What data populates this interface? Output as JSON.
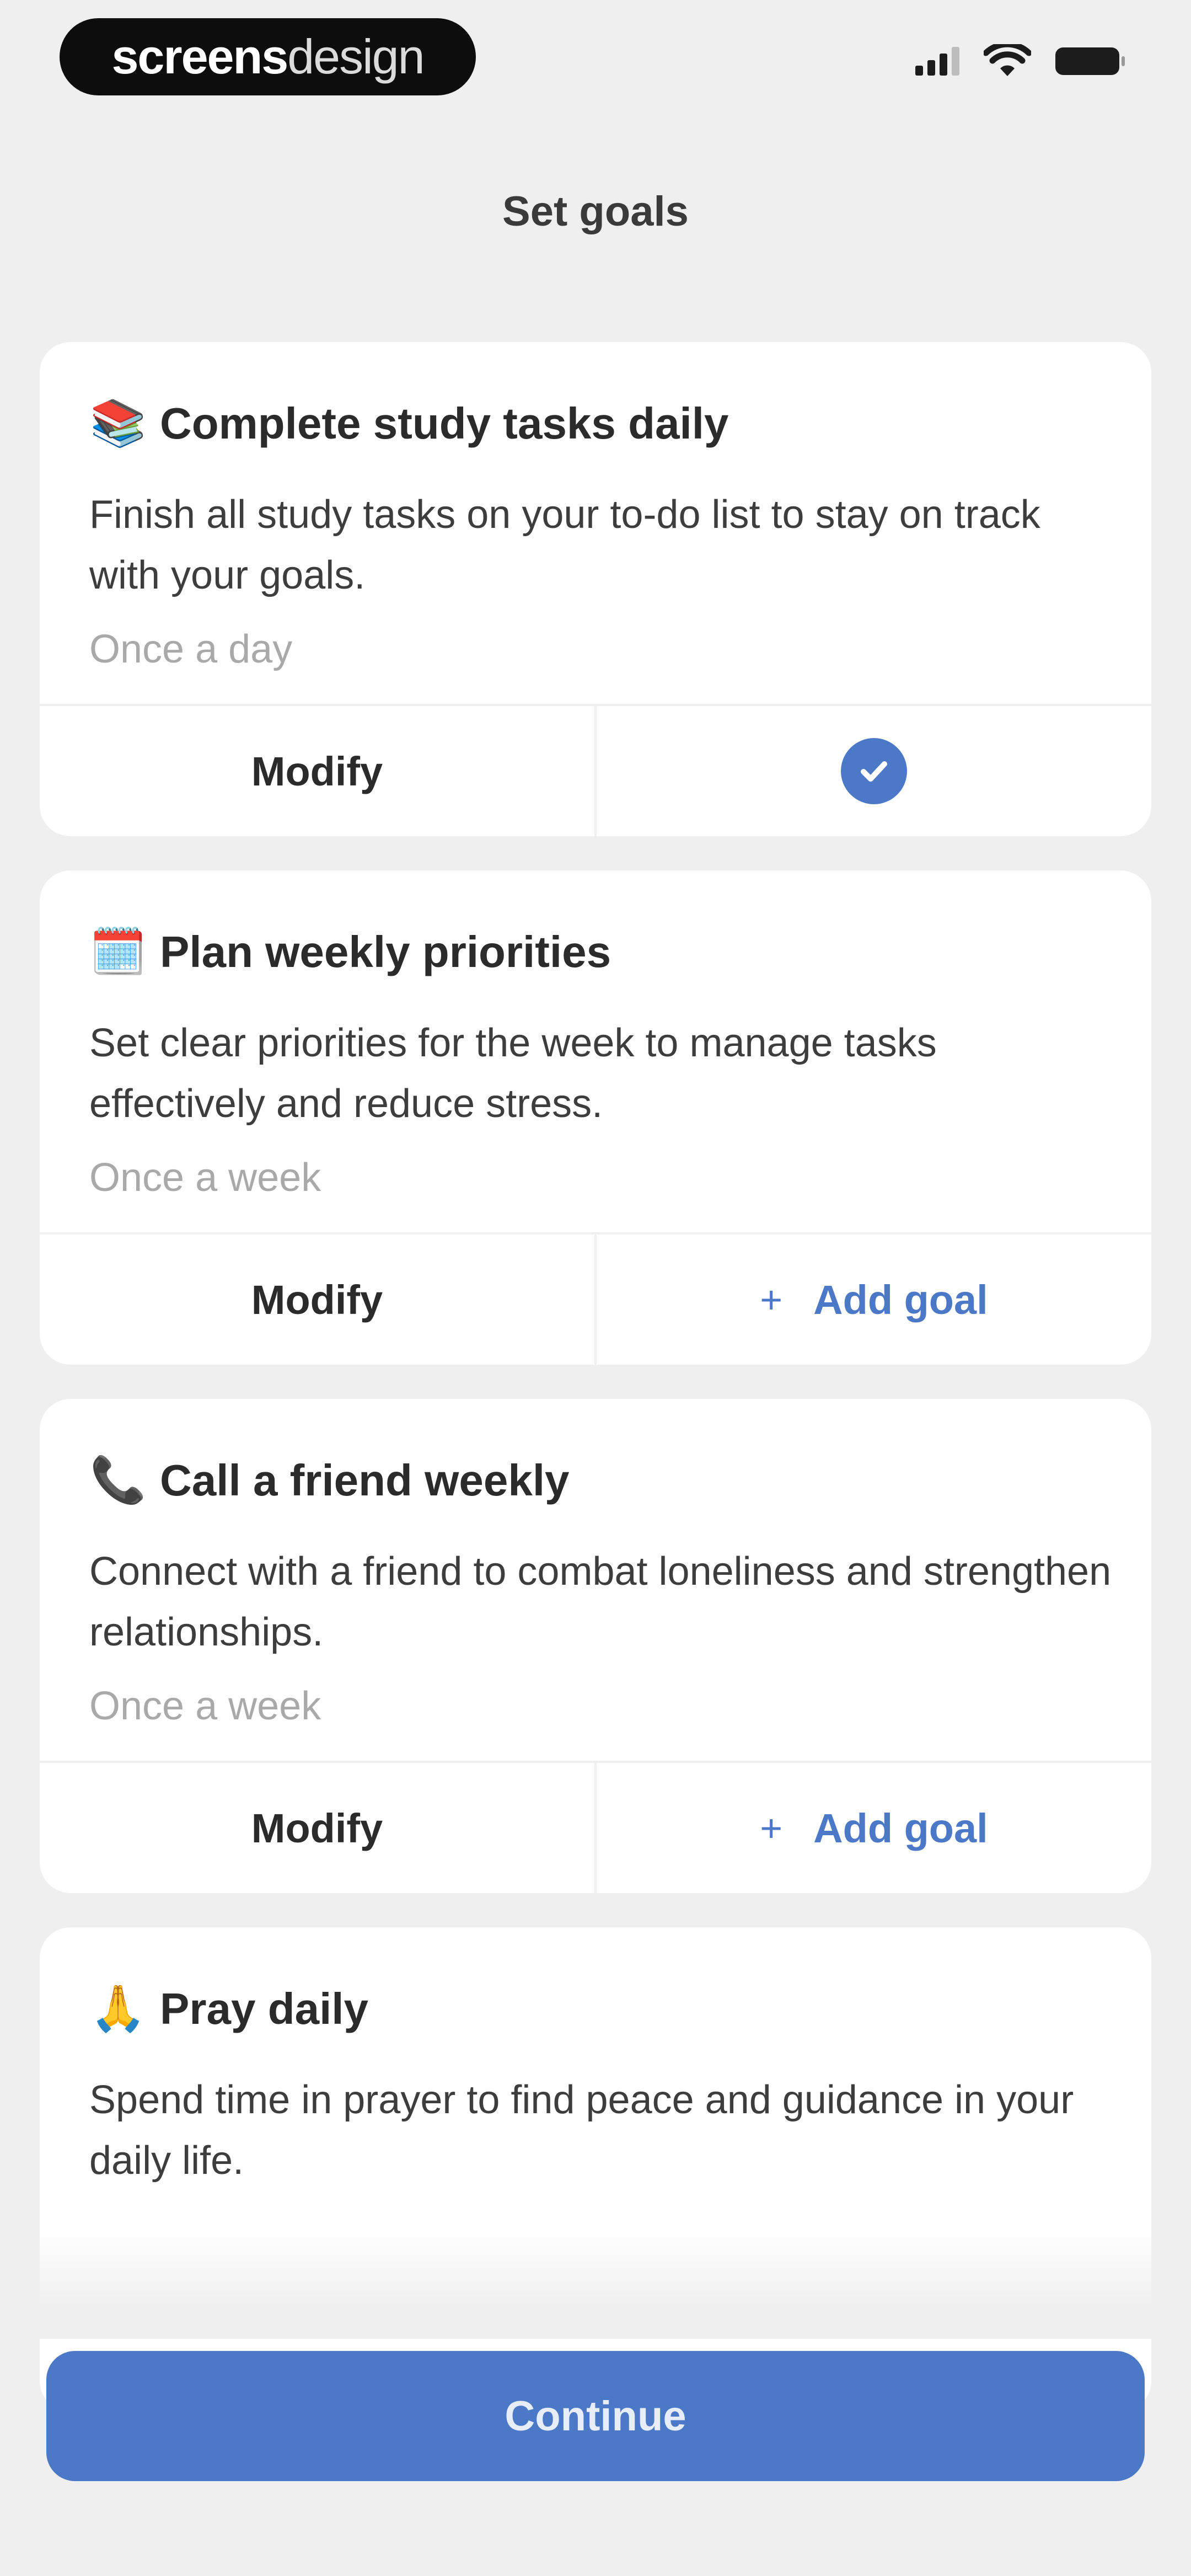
{
  "status_bar": {
    "brand_strong": "screens",
    "brand_light": "design"
  },
  "header": {
    "title": "Set goals"
  },
  "goals": [
    {
      "emoji": "📚",
      "title": "Complete study tasks daily",
      "description": "Finish all study tasks on your to-do list to stay on track with your goals.",
      "frequency": "Once a day",
      "modify_label": "Modify",
      "added": true
    },
    {
      "emoji": "🗓️",
      "title": "Plan weekly priorities",
      "description": "Set clear priorities for the week to manage tasks effectively and reduce stress.",
      "frequency": "Once a week",
      "modify_label": "Modify",
      "plus": "+",
      "add_label": "Add goal",
      "added": false
    },
    {
      "emoji": "📞",
      "title": "Call a friend weekly",
      "description": "Connect with a friend to combat loneliness and strengthen relationships.",
      "frequency": "Once a week",
      "modify_label": "Modify",
      "plus": "+",
      "add_label": "Add goal",
      "added": false
    },
    {
      "emoji": "🙏",
      "title": "Pray daily",
      "description": "Spend time in prayer to find peace and guidance in your daily life."
    }
  ],
  "footer": {
    "continue_label": "Continue"
  },
  "colors": {
    "accent": "#4c78c8",
    "background": "#efefef",
    "card": "#ffffff"
  },
  "icons": {
    "signal": "cellular-signal-icon",
    "wifi": "wifi-icon",
    "battery": "battery-icon",
    "added": "checkmark-circle-icon"
  }
}
